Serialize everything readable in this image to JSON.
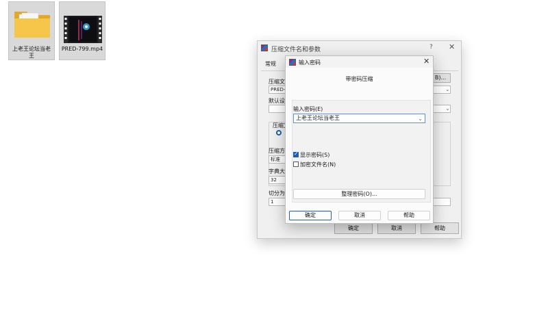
{
  "desktop": {
    "folder_label": "上老王论坛当老王",
    "video_label": "PRED-799.mp4"
  },
  "back_window": {
    "title": "压缩文件名和参数",
    "help_glyph": "?",
    "close_glyph": "✕",
    "tab_general": "常规",
    "label_archive_name": "压缩文",
    "field_archive_name": "PRED-",
    "browse_button": "B)...",
    "label_default": "默认设",
    "label_format": "压缩文",
    "label_method": "压缩方",
    "field_method": "标准",
    "label_dictionary": "字典大",
    "field_dictionary": "32",
    "label_split": "切分为",
    "field_split": "1",
    "ok_button": "确定",
    "cancel_button": "取消",
    "help_button": "帮助"
  },
  "dialog": {
    "title": "输入密码",
    "close_glyph": "✕",
    "subtitle": "带密码压缩",
    "password_label": "输入密码(E)",
    "password_value": "上老王论坛当老王",
    "show_password_label": "显示密码(S)",
    "show_password_checked": true,
    "encrypt_names_label": "加密文件名(N)",
    "encrypt_names_checked": false,
    "organize_button": "整理密码(O)...",
    "ok_button": "确定",
    "cancel_button": "取消",
    "help_button": "帮助"
  }
}
